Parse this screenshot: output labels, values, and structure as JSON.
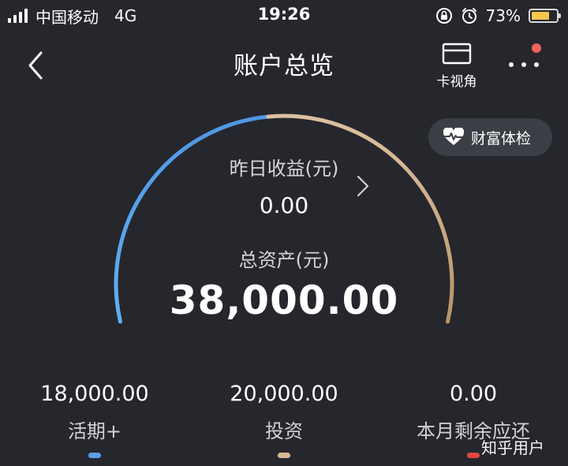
{
  "status": {
    "carrier": "中国移动",
    "network": "4G",
    "time": "19:26",
    "battery": "73%",
    "battery_level": 0.73
  },
  "nav": {
    "title": "账户总览",
    "card_view": "卡视角"
  },
  "wealth_check": "财富体检",
  "gauge": {
    "yesterday_label": "昨日收益(元)",
    "yesterday_value": "0.00",
    "total_label": "总资产(元)",
    "total_value": "38,000.00",
    "blue_fraction": 0.4737,
    "colors": {
      "blue": "#5aa7ee",
      "gold": "#c9a57f"
    }
  },
  "summary": [
    {
      "amount": "18,000.00",
      "label": "活期+",
      "color": "#5a9ee8"
    },
    {
      "amount": "20,000.00",
      "label": "投资",
      "color": "#d8b895"
    },
    {
      "amount": "0.00",
      "label": "本月剩余应还",
      "color": "#e0483f"
    }
  ],
  "watermark": "知乎用户",
  "icons": {
    "back": "chevron-left-icon",
    "card": "card-icon",
    "more": "more-dots-icon",
    "heart": "heartbeat-icon",
    "arrow": "chevron-right-icon",
    "lock": "rotation-lock-icon",
    "alarm": "alarm-icon"
  }
}
